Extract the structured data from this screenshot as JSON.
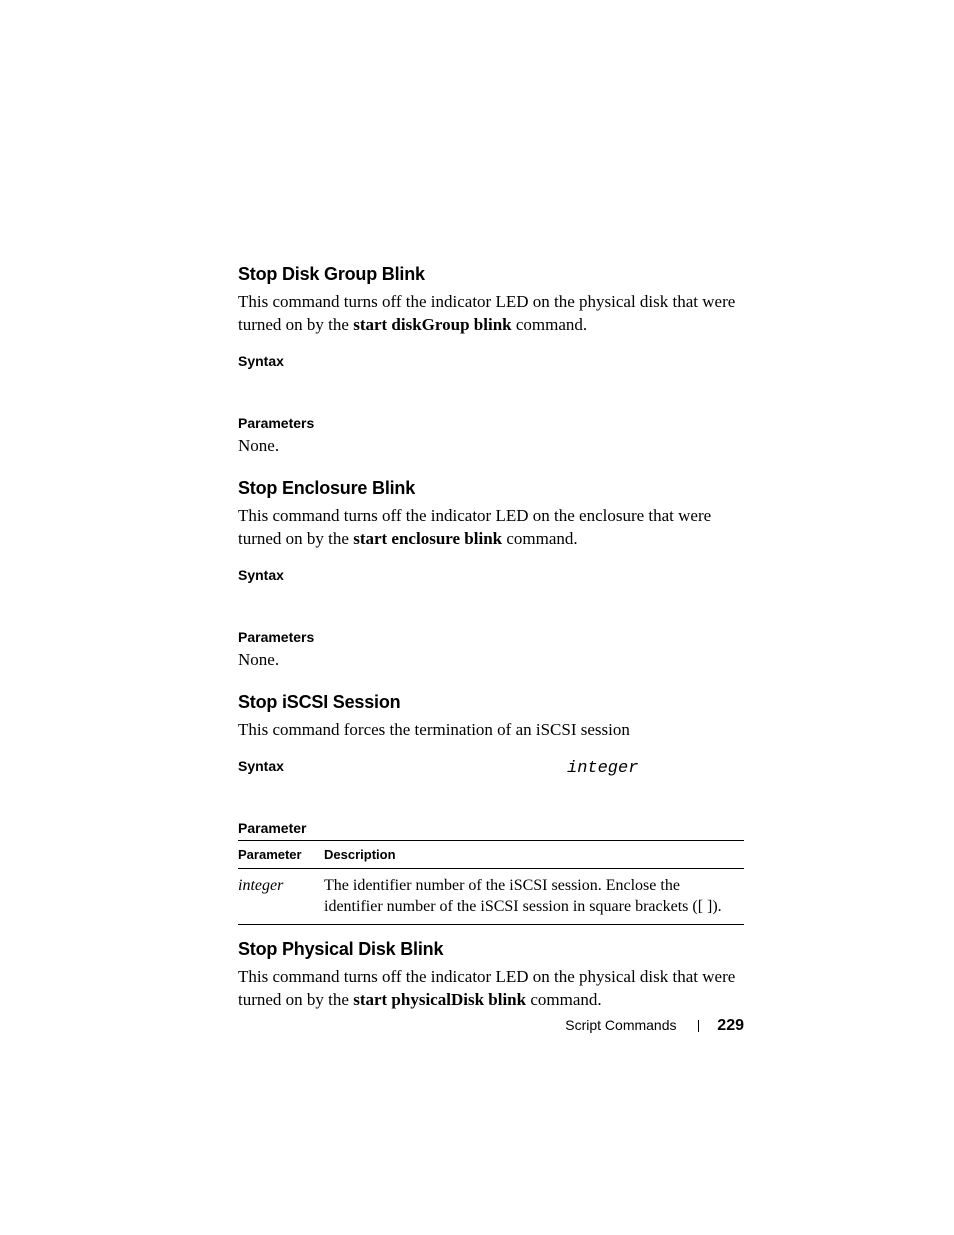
{
  "sections": [
    {
      "title": "Stop Disk Group Blink",
      "body_pre": "This command turns off the indicator LED on the physical disk that were turned on by the ",
      "body_bold": "start diskGroup blink",
      "body_post": " command.",
      "syntax_label": "Syntax",
      "params_label": "Parameters",
      "params_body": "None."
    },
    {
      "title": "Stop Enclosure Blink",
      "body_pre": "This command turns off the indicator LED on the enclosure that were turned on by the ",
      "body_bold": "start enclosure blink",
      "body_post": " command.",
      "syntax_label": "Syntax",
      "params_label": "Parameters",
      "params_body": "None."
    }
  ],
  "iscsi": {
    "title": "Stop iSCSI Session",
    "body": "This command forces the termination of an iSCSI session",
    "syntax_label": "Syntax",
    "syntax_inline": "integer",
    "param_label": "Parameter",
    "table": {
      "head": {
        "c1": "Parameter",
        "c2": "Description"
      },
      "row": {
        "name": "integer",
        "desc": "The identifier number of the iSCSI session. Enclose the identifier number of the iSCSI session in square brackets ([ ])."
      }
    }
  },
  "phys": {
    "title": "Stop Physical Disk Blink",
    "body_pre": "This command turns off the indicator LED on the physical disk that were turned on by the ",
    "body_bold": "start physicalDisk blink",
    "body_post": " command."
  },
  "footer": {
    "section": "Script Commands",
    "page": "229"
  }
}
